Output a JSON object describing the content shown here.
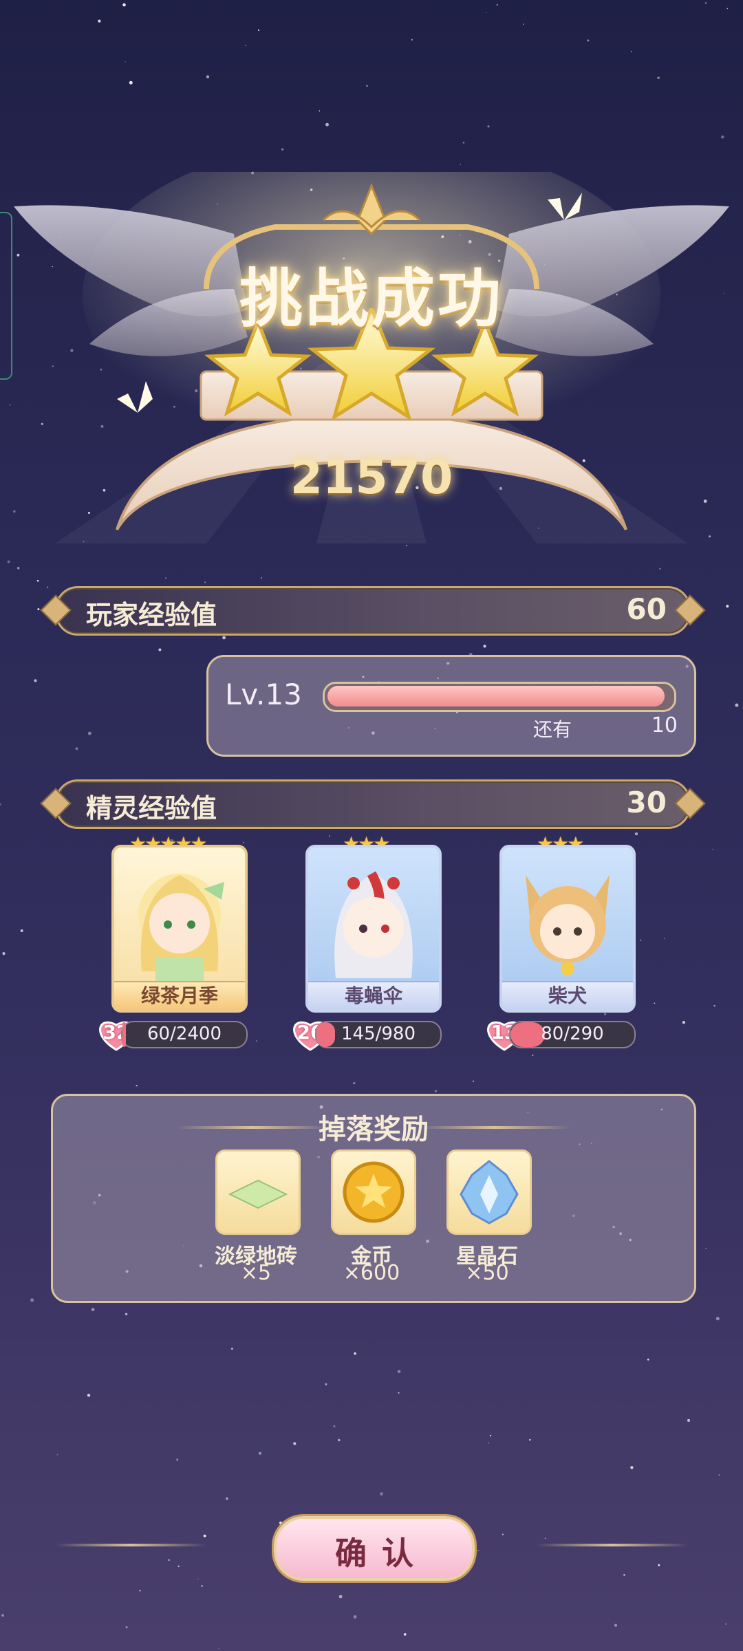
{
  "header": {
    "title": "挑战成功",
    "score": "21570",
    "stars_earned": 3
  },
  "player_exp": {
    "label": "玩家经验值",
    "value": "60"
  },
  "level": {
    "label": "Lv.13",
    "progress": 0.98,
    "remain_label": "还有",
    "remain_value": "10"
  },
  "spirit_exp": {
    "label": "精灵经验值",
    "value": "30"
  },
  "spirits": [
    {
      "name": "绿茶月季",
      "stars": "★★★★★",
      "level": "32",
      "exp": "60/2400",
      "progress": 0.025,
      "theme": "gold"
    },
    {
      "name": "毒蝇伞",
      "stars": "★★★",
      "level": "26",
      "exp": "145/980",
      "progress": 0.148,
      "theme": "blue"
    },
    {
      "name": "柴犬",
      "stars": "★★★",
      "level": "13",
      "exp": "80/290",
      "progress": 0.276,
      "theme": "blue"
    }
  ],
  "drops": {
    "title": "掉落奖励",
    "items": [
      {
        "name": "淡绿地砖",
        "qty": "×5",
        "icon": "green-tile-icon"
      },
      {
        "name": "金币",
        "qty": "×600",
        "icon": "gold-coin-icon"
      },
      {
        "name": "星晶石",
        "qty": "×50",
        "icon": "star-crystal-icon"
      }
    ]
  },
  "confirm": {
    "label": "确认"
  },
  "colors": {
    "accent": "#d9b47a",
    "progress": "#f28c8c",
    "bg": "#2a2955"
  }
}
